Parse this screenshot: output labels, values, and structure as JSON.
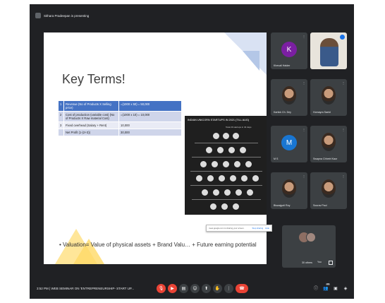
{
  "presenting_banner": "Sithara Pradeepan is presenting",
  "slide": {
    "title": "Key Terms!",
    "table": [
      {
        "num": "1",
        "desc": "Revenue (No of Products X Selling price)",
        "value": "=(1000 x 50) = 50,000"
      },
      {
        "num": "2",
        "desc": "Cost of production (variable cost) (No of Products X Raw material Cost)",
        "value": "=(1000 x 10) = 10,000"
      },
      {
        "num": "3",
        "desc": "Fixed overhead (Salary + Rent)",
        "value": "10,000"
      },
      {
        "num": "",
        "desc": "Net Profit (1-(2+3))",
        "value": "30,000"
      }
    ],
    "infographic_title": "INDIAN UNICORN STARTUPS IN 2021 (TILL AUG)",
    "infographic_subtitle": "Total 29 startups in 34 days",
    "valuation_text": "• Valuation= Value of physical assets + Brand Valu… + Future earning potential"
  },
  "share_popup": {
    "text": "meet.google.com is sharing your screen.",
    "stop_label": "Stop sharing",
    "hide_label": "Hide"
  },
  "participants": [
    {
      "name": "Khevali Halder",
      "initial": "K",
      "color": "#7b1fa2",
      "kind": "avatar"
    },
    {
      "name": "",
      "kind": "video"
    },
    {
      "name": "Kartick Ch. Dey",
      "kind": "photo"
    },
    {
      "name": "Homayra Saeid",
      "kind": "photo"
    },
    {
      "name": "M S",
      "initial": "M",
      "color": "#1976d2",
      "kind": "avatar"
    },
    {
      "name": "Swapna Chhetri Kaur",
      "kind": "photo"
    },
    {
      "name": "Biswajyoti Roy",
      "kind": "photo"
    },
    {
      "name": "Sourav Paul",
      "kind": "photo"
    }
  ],
  "others": {
    "label": "30 others",
    "you_label": "You"
  },
  "bottom_bar": {
    "time": "3:52 PM",
    "meeting_title": "WEB SEMINAR ON 'ENTREPRENEURSHIP- START UP...",
    "people_count": "40"
  },
  "colors": {
    "accent_red": "#ea4335",
    "bar_bg": "#202124",
    "tile_bg": "#3c4043",
    "table_header": "#4472c4"
  }
}
